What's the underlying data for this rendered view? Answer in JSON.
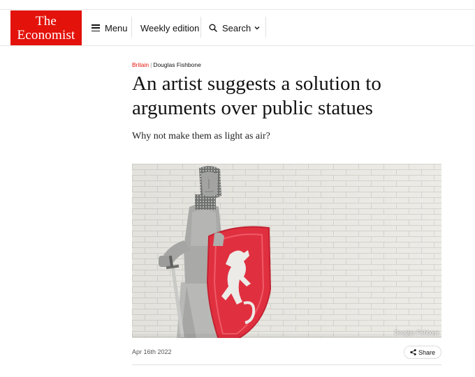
{
  "header": {
    "logo_line1": "The",
    "logo_line2": "Economist",
    "menu_label": "Menu",
    "weekly_label": "Weekly edition",
    "search_label": "Search"
  },
  "article": {
    "section": "Britain",
    "author": "Douglas Fishbone",
    "headline": "An artist suggests a solution to arguments over public statues",
    "standfirst": "Why not make them as light as air?",
    "image_credit": "Douglas Fishbone",
    "date": "Apr 16th 2022",
    "share_label": "Share"
  },
  "colors": {
    "brand_red": "#e3120b"
  },
  "icons": [
    "hamburger-icon",
    "search-icon",
    "chevron-down-icon",
    "share-icon"
  ]
}
